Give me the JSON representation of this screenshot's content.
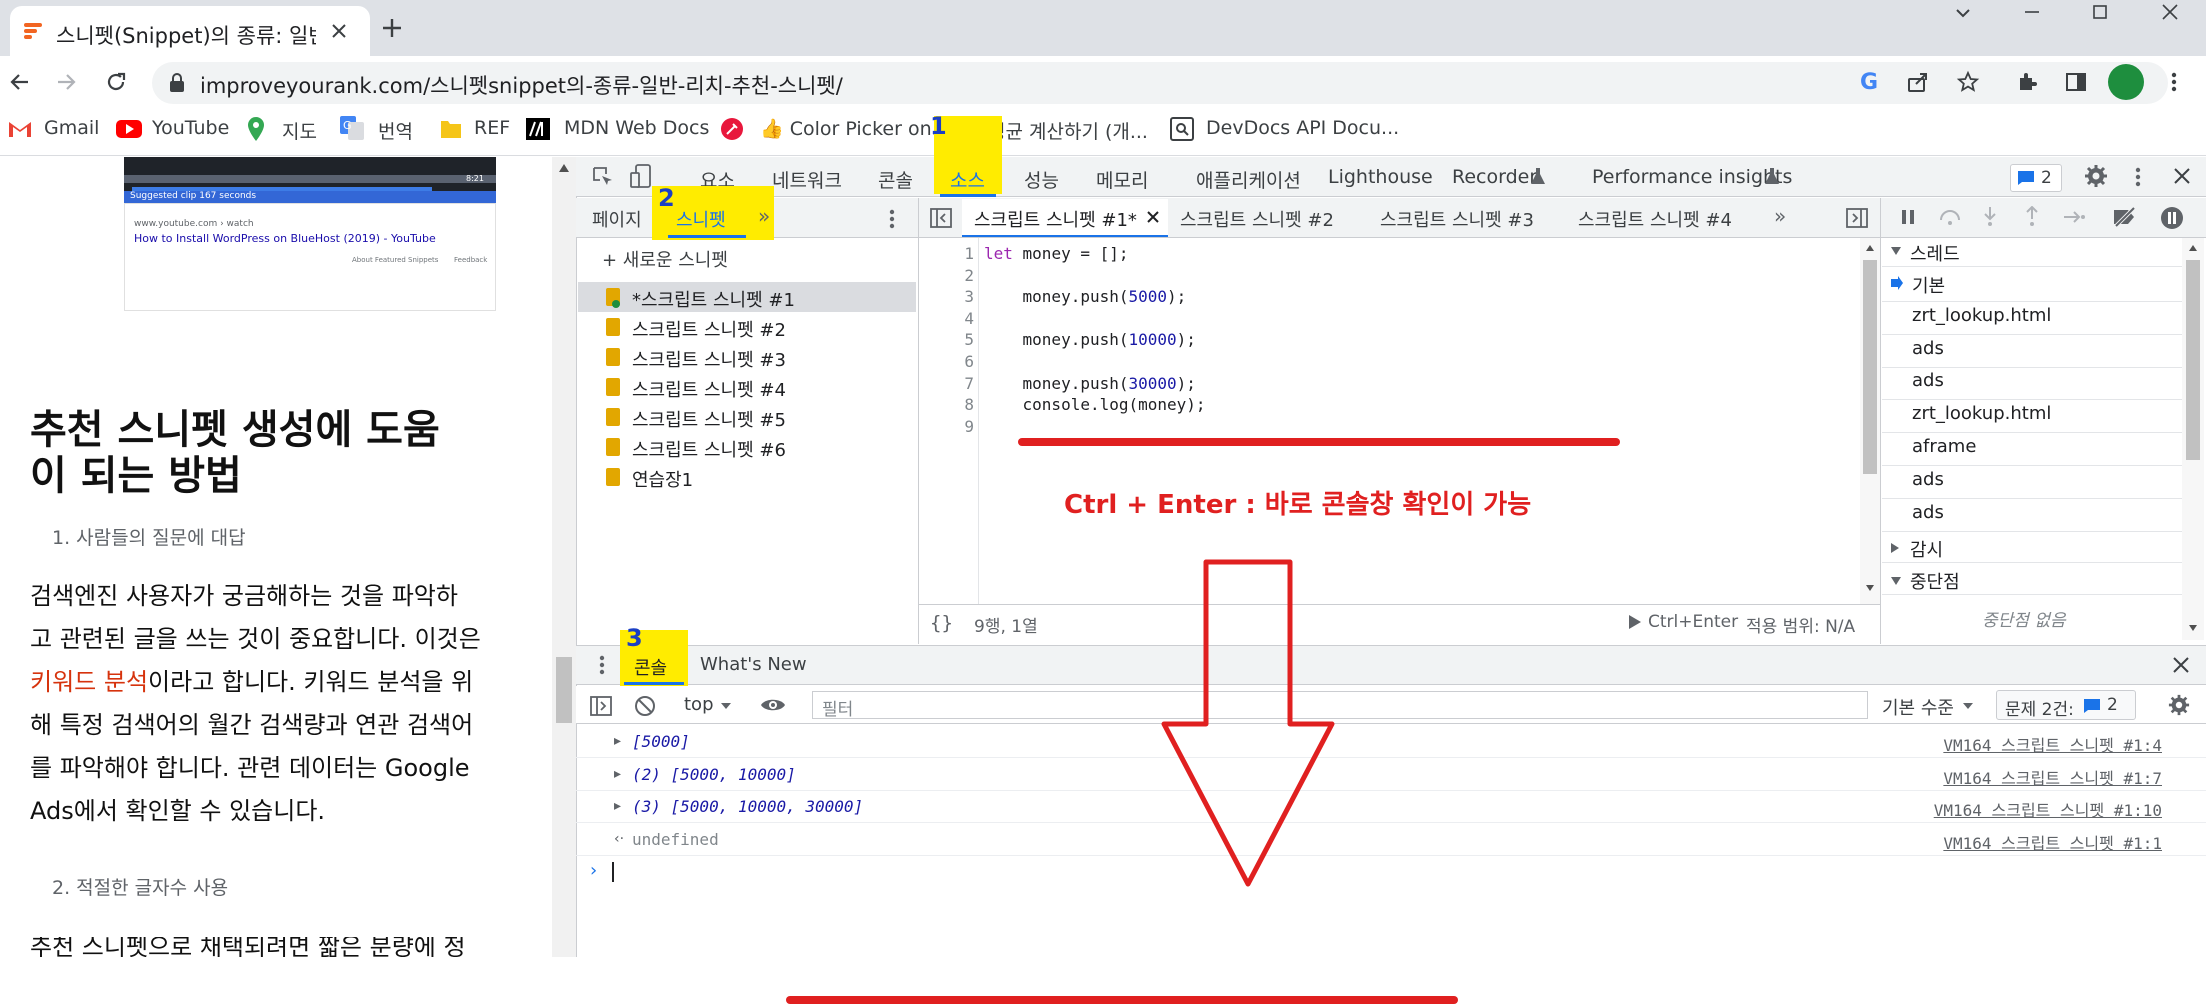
{
  "browser": {
    "tab_title": "스니펫(Snippet)의 종류: 일반, 리치",
    "url": "improveyourank.com/스니펫snippet의-종류-일반-리치-추천-스니펫/",
    "bookmarks": [
      {
        "icon": "gmail-icon",
        "label": "Gmail"
      },
      {
        "icon": "youtube-icon",
        "label": "YouTube"
      },
      {
        "icon": "maps-icon",
        "label": "지도"
      },
      {
        "icon": "translate-icon",
        "label": "번역"
      },
      {
        "icon": "folder-icon",
        "label": "REF"
      },
      {
        "icon": "mdn-icon",
        "label": "MDN Web Docs"
      },
      {
        "icon": "colorpicker-icon",
        "label": "👍 Color Picker on..."
      },
      {
        "icon": "calculator-icon",
        "label": "평균 계산하기 (개..."
      },
      {
        "icon": "devdocs-icon",
        "label": "DevDocs API Docu..."
      }
    ]
  },
  "page": {
    "thumb_caption": "Suggested clip 167 seconds",
    "thumb_time": "8:21",
    "thumb_source": "www.youtube.com › watch",
    "thumb_link": "How to Install WordPress on BlueHost (2019) - YouTube",
    "thumb_about": "About Featured Snippets",
    "thumb_feedback": "Feedback",
    "heading_line1": "추천 스니펫 생성에 도움",
    "heading_line2": "이 되는 방법",
    "sub1": "1. 사람들의 질문에 대답",
    "para_l1": "검색엔진 사용자가 궁금해하는 것을 파악하",
    "para_l2": "고 관련된 글을 쓰는 것이 중요합니다. 이것은",
    "para_l3_link": "키워드 분석",
    "para_l3_rest": "이라고 합니다. 키워드 분석을 위",
    "para_l4": "해 특정 검색어의 월간 검색량과 연관 검색어",
    "para_l5": "를 파악해야 합니다. 관련 데이터는 Google",
    "para_l6": "Ads에서 확인할 수 있습니다.",
    "sub2": "2. 적절한 글자수 사용",
    "cut_line": "추천 스니펫으로 채택되려면 짧은 분량에 정"
  },
  "devtools": {
    "tabs": [
      "요소",
      "네트워크",
      "콘솔",
      "소스",
      "성능",
      "메모리",
      "애플리케이션",
      "Lighthouse",
      "Recorder",
      "Performance insights"
    ],
    "issues_count": "2",
    "nav_tabs": [
      "페이지",
      "스니펫",
      "»"
    ],
    "new_snippet": "+ 새로운 스니펫",
    "snippets": [
      "*스크립트 스니펫 #1",
      "스크립트 스니펫 #2",
      "스크립트 스니펫 #3",
      "스크립트 스니펫 #4",
      "스크립트 스니펫 #5",
      "스크립트 스니펫 #6",
      "연습장1"
    ],
    "editor_tabs": [
      "스크립트 스니펫 #1*",
      "스크립트 스니펫 #2",
      "스크립트 스니펫 #3",
      "스크립트 스니펫 #4",
      "»"
    ],
    "code_lines": [
      {
        "n": "1",
        "text": "let money = [];"
      },
      {
        "n": "2",
        "text": ""
      },
      {
        "n": "3",
        "text": "    money.push(5000);"
      },
      {
        "n": "4",
        "text": ""
      },
      {
        "n": "5",
        "text": "    money.push(10000);"
      },
      {
        "n": "6",
        "text": ""
      },
      {
        "n": "7",
        "text": "    money.push(30000);"
      },
      {
        "n": "8",
        "text": "    console.log(money);"
      },
      {
        "n": "9",
        "text": ""
      }
    ],
    "status_pos": "9행, 1열",
    "status_run": "Ctrl+Enter",
    "status_scope": "적용 범위: N/A",
    "side": {
      "threads_header": "스레드",
      "threads": [
        "기본",
        "zrt_lookup.html",
        "ads",
        "ads",
        "zrt_lookup.html",
        "aframe",
        "ads",
        "ads"
      ],
      "watch_header": "감시",
      "breakpoints_header": "중단점",
      "no_breakpoints": "중단점 없음"
    },
    "drawer_tabs": [
      "콘솔",
      "What's New"
    ],
    "console_toolbar": {
      "context": "top",
      "filter_placeholder": "필터",
      "level": "기본 수준",
      "issues_label": "문제 2건:",
      "issues_count": "2"
    },
    "console_rows": [
      {
        "msg": "[5000]",
        "src": "VM164 스크립트 스니펫 #1:4"
      },
      {
        "msg": "(2) [5000, 10000]",
        "src": "VM164 스크립트 스니펫 #1:7"
      },
      {
        "msg": "(3) [5000, 10000, 30000]",
        "src": "VM164 스크립트 스니펫 #1:10"
      },
      {
        "msg": "undefined",
        "src": "VM164 스크립트 스니펫 #1:1"
      }
    ]
  },
  "annotations": {
    "note": "Ctrl + Enter : 바로 콘솔창 확인이 가능",
    "marker1": "1",
    "marker2": "2",
    "marker3": "3",
    "highlight_color": "#ffec00",
    "annotation_color": "#e02020"
  }
}
